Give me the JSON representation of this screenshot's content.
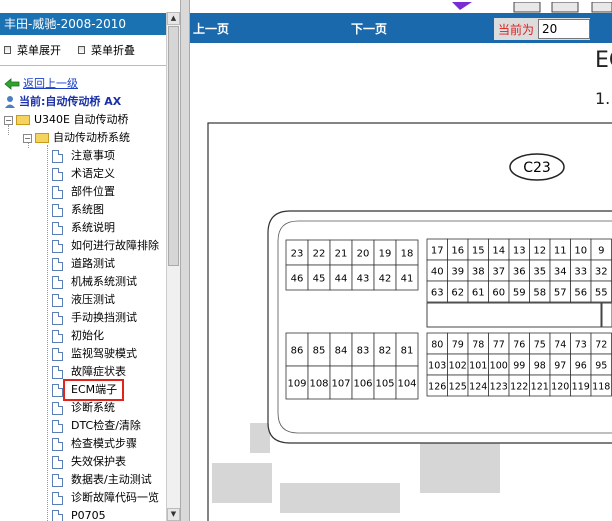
{
  "left": {
    "title": "丰田-威驰-2008-2010",
    "expand_label": "菜单展开",
    "collapse_label": "菜单折叠",
    "back_label": "返回上一级",
    "current_label": "当前:自动传动桥 AX",
    "tree": {
      "level1": "U340E 自动传动桥",
      "level2": "自动传动桥系统",
      "items": [
        "注意事项",
        "术语定义",
        "部件位置",
        "系统图",
        "系统说明",
        "如何进行故障排除",
        "道路测试",
        "机械系统测试",
        "液压测试",
        "手动换挡测试",
        "初始化",
        "监视驾驶模式",
        "故障症状表",
        "ECM端子",
        "诊断系统",
        "DTC检查/清除",
        "检查模式步骤",
        "失效保护表",
        "数据表/主动测试",
        "诊断故障代码一览",
        "P0705"
      ]
    }
  },
  "viewer": {
    "prev_label": "上一页",
    "next_label": "下一页",
    "current_page_label": "当前为",
    "current_page_value": "20",
    "heading": "EC",
    "step": "1."
  },
  "diagram": {
    "connector": "C23",
    "left_block_top": [
      "23",
      "22",
      "21",
      "20",
      "19",
      "18"
    ],
    "left_block_mid": [
      "46",
      "45",
      "44",
      "43",
      "42",
      "41"
    ],
    "right_block_r1": [
      "17",
      "16",
      "15",
      "14",
      "13",
      "12",
      "11",
      "10",
      "9"
    ],
    "right_block_r2": [
      "40",
      "39",
      "38",
      "37",
      "36",
      "35",
      "34",
      "33",
      "32"
    ],
    "right_block_r3": [
      "63",
      "62",
      "61",
      "60",
      "59",
      "58",
      "57",
      "56",
      "55"
    ],
    "left_lower_r1": [
      "86",
      "85",
      "84",
      "83",
      "82",
      "81"
    ],
    "left_lower_r2": [
      "109",
      "108",
      "107",
      "106",
      "105",
      "104"
    ],
    "right_lower_r1": [
      "80",
      "79",
      "78",
      "77",
      "76",
      "75",
      "74",
      "73",
      "72"
    ],
    "right_lower_r2": [
      "103",
      "102",
      "101",
      "100",
      "99",
      "98",
      "97",
      "96",
      "95"
    ],
    "right_lower_r3": [
      "126",
      "125",
      "124",
      "123",
      "122",
      "121",
      "120",
      "119",
      "118"
    ]
  },
  "colors": {
    "title_bar": "#1b72b3",
    "nav_bar": "#1a69ad",
    "highlight": "#e0241b",
    "current_label": "#e02020"
  }
}
